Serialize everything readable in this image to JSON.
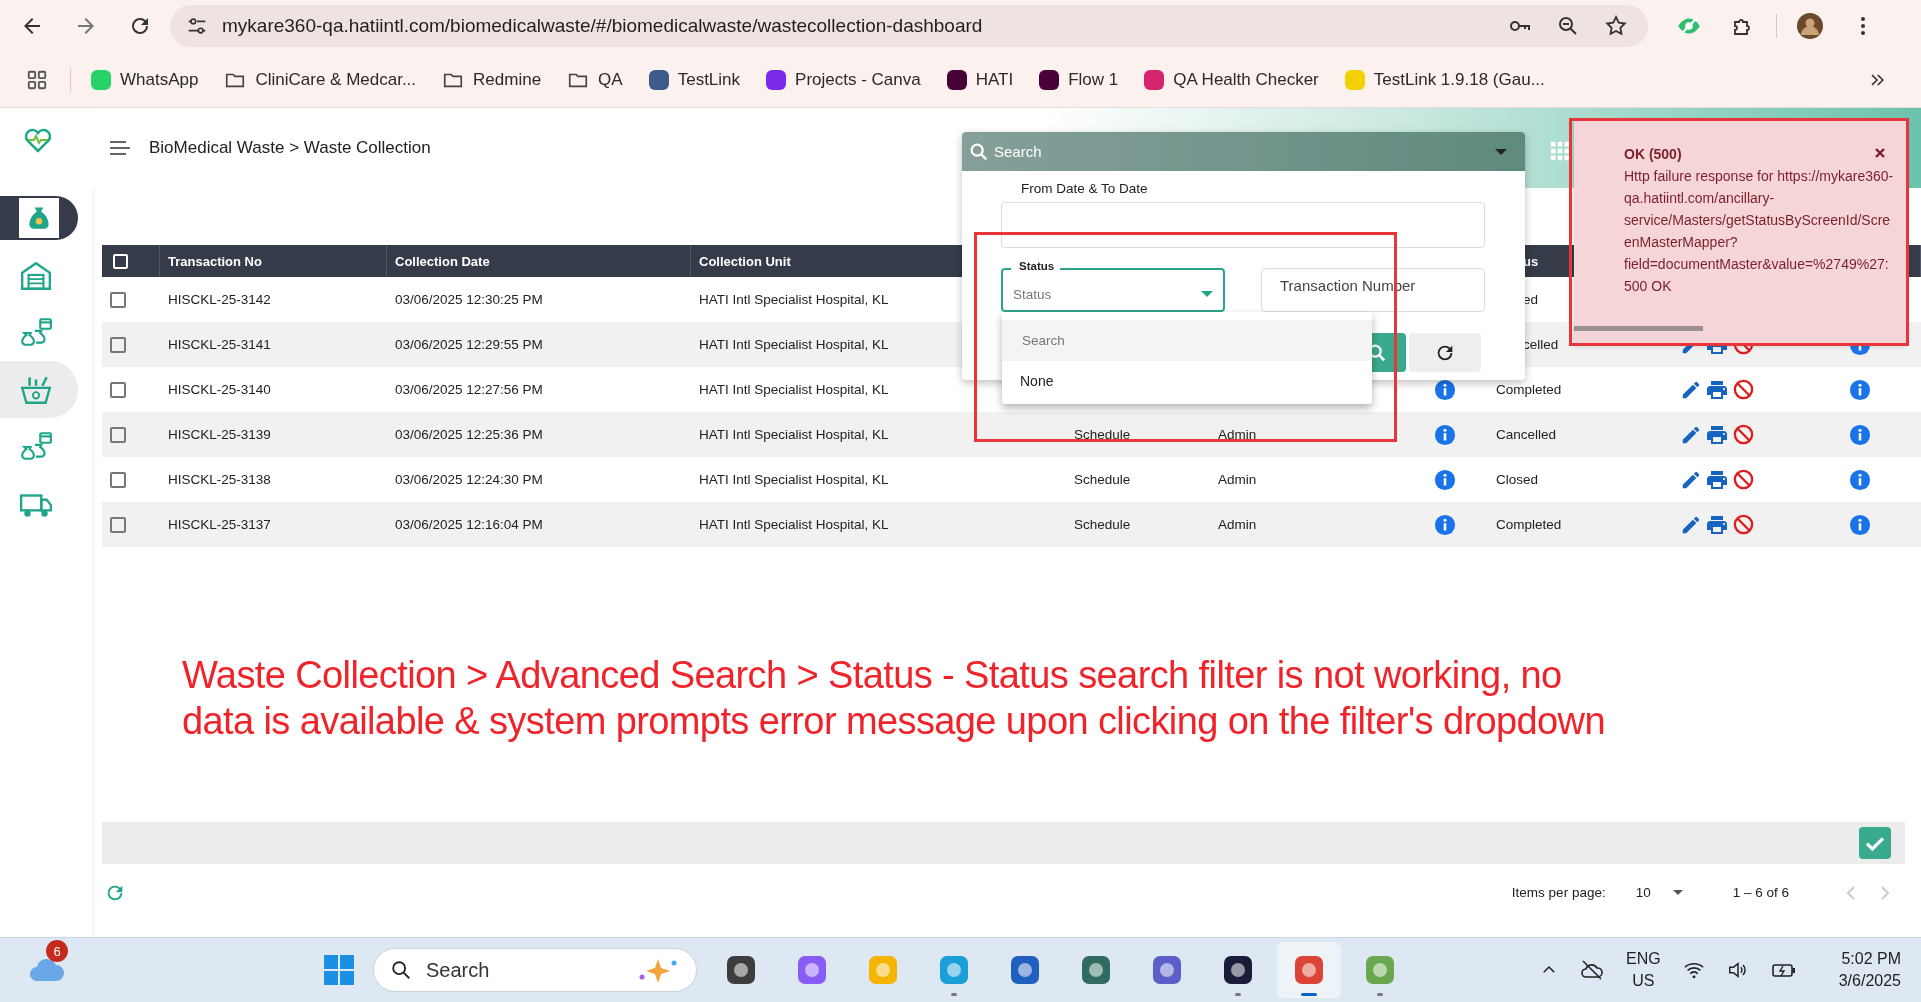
{
  "browser": {
    "url": "mykare360-qa.hatiintl.com/biomedicalwaste/#/biomedicalwaste/wastecollection-dashboard",
    "bookmarks": [
      {
        "kind": "site",
        "label": "WhatsApp",
        "color": "#25d366"
      },
      {
        "kind": "folder",
        "label": "CliniCare & Medcar..."
      },
      {
        "kind": "folder",
        "label": "Redmine"
      },
      {
        "kind": "folder",
        "label": "QA"
      },
      {
        "kind": "site",
        "label": "TestLink",
        "color": "#3c5a8a"
      },
      {
        "kind": "site",
        "label": "Projects - Canva",
        "color": "#7d2ae8"
      },
      {
        "kind": "site",
        "label": "HATI",
        "color": "#470137"
      },
      {
        "kind": "site",
        "label": "Flow 1",
        "color": "#470137"
      },
      {
        "kind": "site",
        "label": "QA Health Checker",
        "color": "#d6246e"
      },
      {
        "kind": "site",
        "label": "TestLink 1.9.18 (Gau...",
        "color": "#f2d100"
      }
    ]
  },
  "sidebar": {
    "items": [
      {
        "selected": true,
        "hovered": false
      },
      {
        "selected": false,
        "hovered": false
      },
      {
        "selected": false,
        "hovered": false
      },
      {
        "selected": false,
        "hovered": true
      },
      {
        "selected": false,
        "hovered": false
      },
      {
        "selected": false,
        "hovered": false
      }
    ]
  },
  "header": {
    "breadcrumb": "BioMedical Waste > Waste Collection"
  },
  "table": {
    "all_checked": false,
    "columns": [
      "Transaction No",
      "Collection Date",
      "Collection Unit",
      "us"
    ],
    "rows": [
      {
        "checked": false,
        "transaction_no": "HISCKL-25-3142",
        "collection_date": "03/06/2025 12:30:25 PM",
        "collection_unit": "HATI Intl Specialist Hospital, KL",
        "status": "ed",
        "info_icon": false
      },
      {
        "checked": false,
        "transaction_no": "HISCKL-25-3141",
        "collection_date": "03/06/2025 12:29:55 PM",
        "collection_unit": "HATI Intl Specialist Hospital, KL",
        "status": "celled",
        "info_icon": false,
        "actions": true,
        "details_icon": true
      },
      {
        "checked": false,
        "transaction_no": "HISCKL-25-3140",
        "collection_date": "03/06/2025 12:27:56 PM",
        "collection_unit": "HATI Intl Specialist Hospital, KL",
        "status": "Completed",
        "info_icon": true,
        "actions": true,
        "details_icon": true
      },
      {
        "checked": false,
        "transaction_no": "HISCKL-25-3139",
        "collection_date": "03/06/2025 12:25:36 PM",
        "collection_unit": "HATI Intl Specialist Hospital, KL",
        "column_5": "Schedule",
        "column_6": "Admin",
        "status": "Cancelled",
        "info_icon": true,
        "actions": true,
        "details_icon": true
      },
      {
        "checked": false,
        "transaction_no": "HISCKL-25-3138",
        "collection_date": "03/06/2025 12:24:30 PM",
        "collection_unit": "HATI Intl Specialist Hospital, KL",
        "column_5": "Schedule",
        "column_6": "Admin",
        "status": "Closed",
        "info_icon": true,
        "actions": true,
        "details_icon": true
      },
      {
        "checked": false,
        "transaction_no": "HISCKL-25-3137",
        "collection_date": "03/06/2025 12:16:04 PM",
        "collection_unit": "HATI Intl Specialist Hospital, KL",
        "column_5": "Schedule",
        "column_6": "Admin",
        "status": "Completed",
        "info_icon": true,
        "actions": true,
        "details_icon": true
      }
    ]
  },
  "footer": {
    "items_per_page_label": "Items per page:",
    "page_size": "10",
    "range": "1 – 6 of 6"
  },
  "search_panel": {
    "placeholder": "Search",
    "date_label": "From Date & To Date",
    "status_field": {
      "label": "Status",
      "placeholder": "Status",
      "expanded": true
    },
    "transaction_field": {
      "placeholder": "Transaction Number"
    },
    "status_menu": {
      "search_placeholder": "Search",
      "options": [
        "None"
      ]
    }
  },
  "toast": {
    "title": "OK (500)",
    "message": "Http failure response for https://mykare360-qa.hatiintl.com/ancillary-service/Masters/getStatusByScreenId/ScreenMasterMapper?field=documentMaster&value=%2749%27: 500 OK",
    "level": 0.39
  },
  "annotation": {
    "lines": [
      "Waste Collection > Advanced Search > Status - Status search filter is not working, no",
      "data is available & system prompts error message upon clicking on the filter's dropdown"
    ]
  },
  "taskbar": {
    "weather_badge": "6",
    "search_placeholder": "Search",
    "apps": [
      {
        "color": "#3d3d3d",
        "running": false,
        "active": false
      },
      {
        "color": "#8a5cf6",
        "running": false,
        "active": false
      },
      {
        "color": "#f4b400",
        "running": false,
        "active": false
      },
      {
        "color": "#1a9fd8",
        "running": true,
        "active": false
      },
      {
        "color": "#1f5fbf",
        "running": false,
        "active": false
      },
      {
        "color": "#2f6b5e",
        "running": false,
        "active": false
      },
      {
        "color": "#5b5fc7",
        "running": false,
        "active": false
      },
      {
        "color": "#1b1b3a",
        "running": true,
        "active": false
      },
      {
        "color": "#db4437",
        "running": true,
        "active": true
      },
      {
        "color": "#6aa84f",
        "running": true,
        "active": false
      }
    ],
    "language": "ENG",
    "region": "US",
    "time": "5:02 PM",
    "date": "3/6/2025"
  }
}
